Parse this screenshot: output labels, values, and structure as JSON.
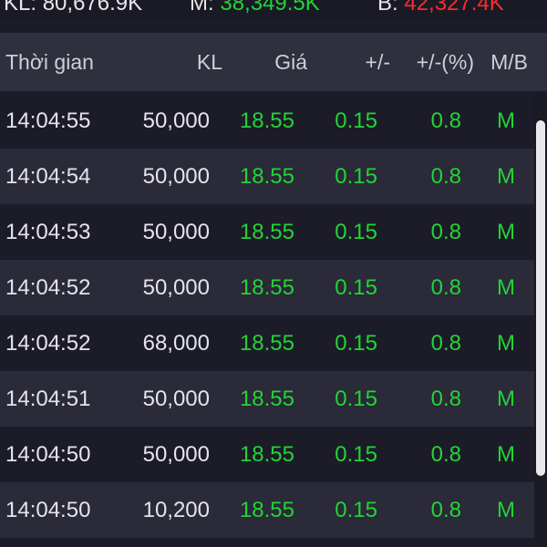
{
  "summary": {
    "kl_label": "KL:",
    "kl_value": "80,676.9K",
    "mua_label": "M:",
    "mua_value": "38,349.5K",
    "ban_label": "B:",
    "ban_value": "42,327.4K",
    "colors": {
      "up": "#22d435",
      "down": "#ff2b2b"
    }
  },
  "header": {
    "time": "Thời gian",
    "kl": "KL",
    "gia": "Giá",
    "chg": "+/-",
    "pct": "+/-(%)",
    "mb": "M/B"
  },
  "rows": [
    {
      "time": "14:04:55",
      "kl": "50,000",
      "gia": "18.55",
      "chg": "0.15",
      "pct": "0.8",
      "mb": "M"
    },
    {
      "time": "14:04:54",
      "kl": "50,000",
      "gia": "18.55",
      "chg": "0.15",
      "pct": "0.8",
      "mb": "M"
    },
    {
      "time": "14:04:53",
      "kl": "50,000",
      "gia": "18.55",
      "chg": "0.15",
      "pct": "0.8",
      "mb": "M"
    },
    {
      "time": "14:04:52",
      "kl": "50,000",
      "gia": "18.55",
      "chg": "0.15",
      "pct": "0.8",
      "mb": "M"
    },
    {
      "time": "14:04:52",
      "kl": "68,000",
      "gia": "18.55",
      "chg": "0.15",
      "pct": "0.8",
      "mb": "M"
    },
    {
      "time": "14:04:51",
      "kl": "50,000",
      "gia": "18.55",
      "chg": "0.15",
      "pct": "0.8",
      "mb": "M"
    },
    {
      "time": "14:04:50",
      "kl": "50,000",
      "gia": "18.55",
      "chg": "0.15",
      "pct": "0.8",
      "mb": "M"
    },
    {
      "time": "14:04:50",
      "kl": "10,200",
      "gia": "18.55",
      "chg": "0.15",
      "pct": "0.8",
      "mb": "M"
    }
  ]
}
